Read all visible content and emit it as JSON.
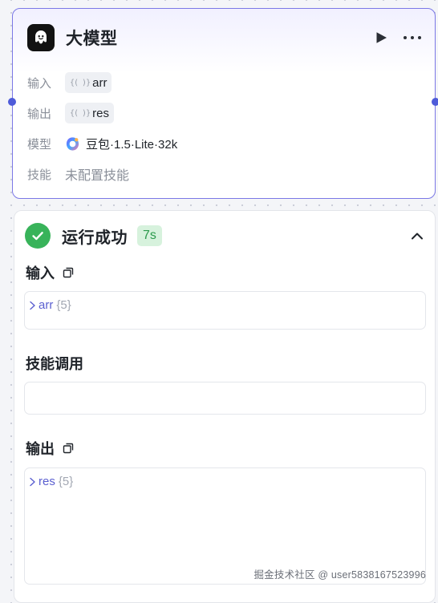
{
  "node": {
    "title": "大模型",
    "icon": "bot-icon",
    "actions": {
      "run_icon": "play-icon",
      "more_icon": "more-icon"
    },
    "params": {
      "input": {
        "label": "输入",
        "value": "arr",
        "icon": "variable-braces-icon"
      },
      "output": {
        "label": "输出",
        "value": "res",
        "icon": "variable-braces-icon"
      },
      "model": {
        "label": "模型",
        "value": "豆包·1.5·Lite·32k",
        "icon": "doubao-logo-icon"
      },
      "skill": {
        "label": "技能",
        "value": "未配置技能"
      }
    },
    "brace_glyph": "{( )}"
  },
  "result": {
    "status": "运行成功",
    "duration": "7s",
    "status_color": "#38b35a",
    "sections": {
      "input": {
        "title": "输入",
        "key": "arr",
        "count": "{5}"
      },
      "skill_call": {
        "title": "技能调用"
      },
      "output": {
        "title": "输出",
        "key": "res",
        "count": "{5}"
      }
    }
  },
  "watermark": "掘金技术社区 @ user5838167523996",
  "colors": {
    "accent": "#7b78e6",
    "port": "#4e5bd9",
    "success": "#38b35a",
    "json_key": "#5a5fd0"
  }
}
